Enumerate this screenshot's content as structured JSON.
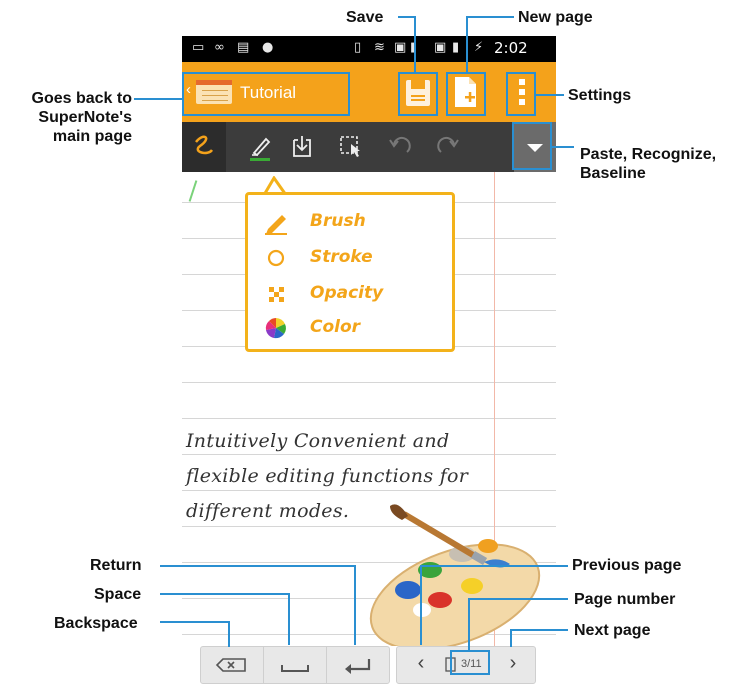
{
  "status_bar": {
    "time": "2:02"
  },
  "app_bar": {
    "title": "Tutorial"
  },
  "callouts": {
    "save": "Save",
    "new_page": "New page",
    "back_line1": "Goes back to",
    "back_line2": "SuperNote's",
    "back_line3": "main page",
    "settings": "Settings",
    "paste_line1": "Paste, Recognize,",
    "paste_line2": "Baseline",
    "return": "Return",
    "space": "Space",
    "backspace": "Backspace",
    "previous_page": "Previous page",
    "page_number": "Page number",
    "next_page": "Next page"
  },
  "brush_popup": {
    "items": [
      {
        "label": "Brush",
        "icon": "pencil-icon"
      },
      {
        "label": "Stroke",
        "icon": "circle-outline-icon"
      },
      {
        "label": "Opacity",
        "icon": "opacity-icon"
      },
      {
        "label": "Color",
        "icon": "color-wheel-icon"
      }
    ]
  },
  "handwriting": {
    "line1": "Intuitively Convenient and",
    "line2": "flexible editing functions for",
    "line3": "different modes."
  },
  "bottom_bar": {
    "page_number": "3/11"
  },
  "colors": {
    "accent": "#f4a21b",
    "callout_line": "#2a8fd1",
    "toolbar": "#3c3c3c"
  }
}
